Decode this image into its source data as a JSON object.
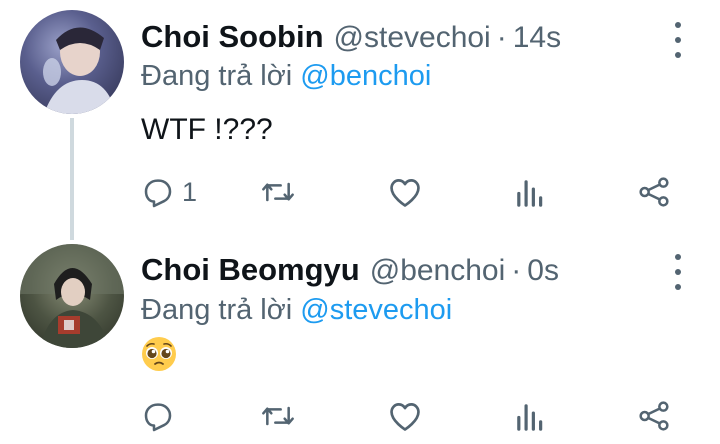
{
  "tweets": [
    {
      "name": "Choi Soobin",
      "handle": "@stevechoi",
      "separator": "·",
      "time": "14s",
      "reply_prefix": "Đang trả lời",
      "reply_to": "@benchoi",
      "content": "WTF !???",
      "reply_count": "1"
    },
    {
      "name": "Choi Beomgyu",
      "handle": "@benchoi",
      "separator": "·",
      "time": "0s",
      "reply_prefix": "Đang trả lời",
      "reply_to": "@stevechoi",
      "content_emoji": "pleading-face-emoji",
      "reply_count": ""
    }
  ],
  "colors": {
    "text": "#0f1419",
    "secondary": "#536471",
    "link": "#1d9bf0",
    "thread_line": "#cfd9de"
  },
  "icons": [
    "reply-icon",
    "retweet-icon",
    "like-icon",
    "stats-icon",
    "share-icon",
    "more-icon"
  ]
}
